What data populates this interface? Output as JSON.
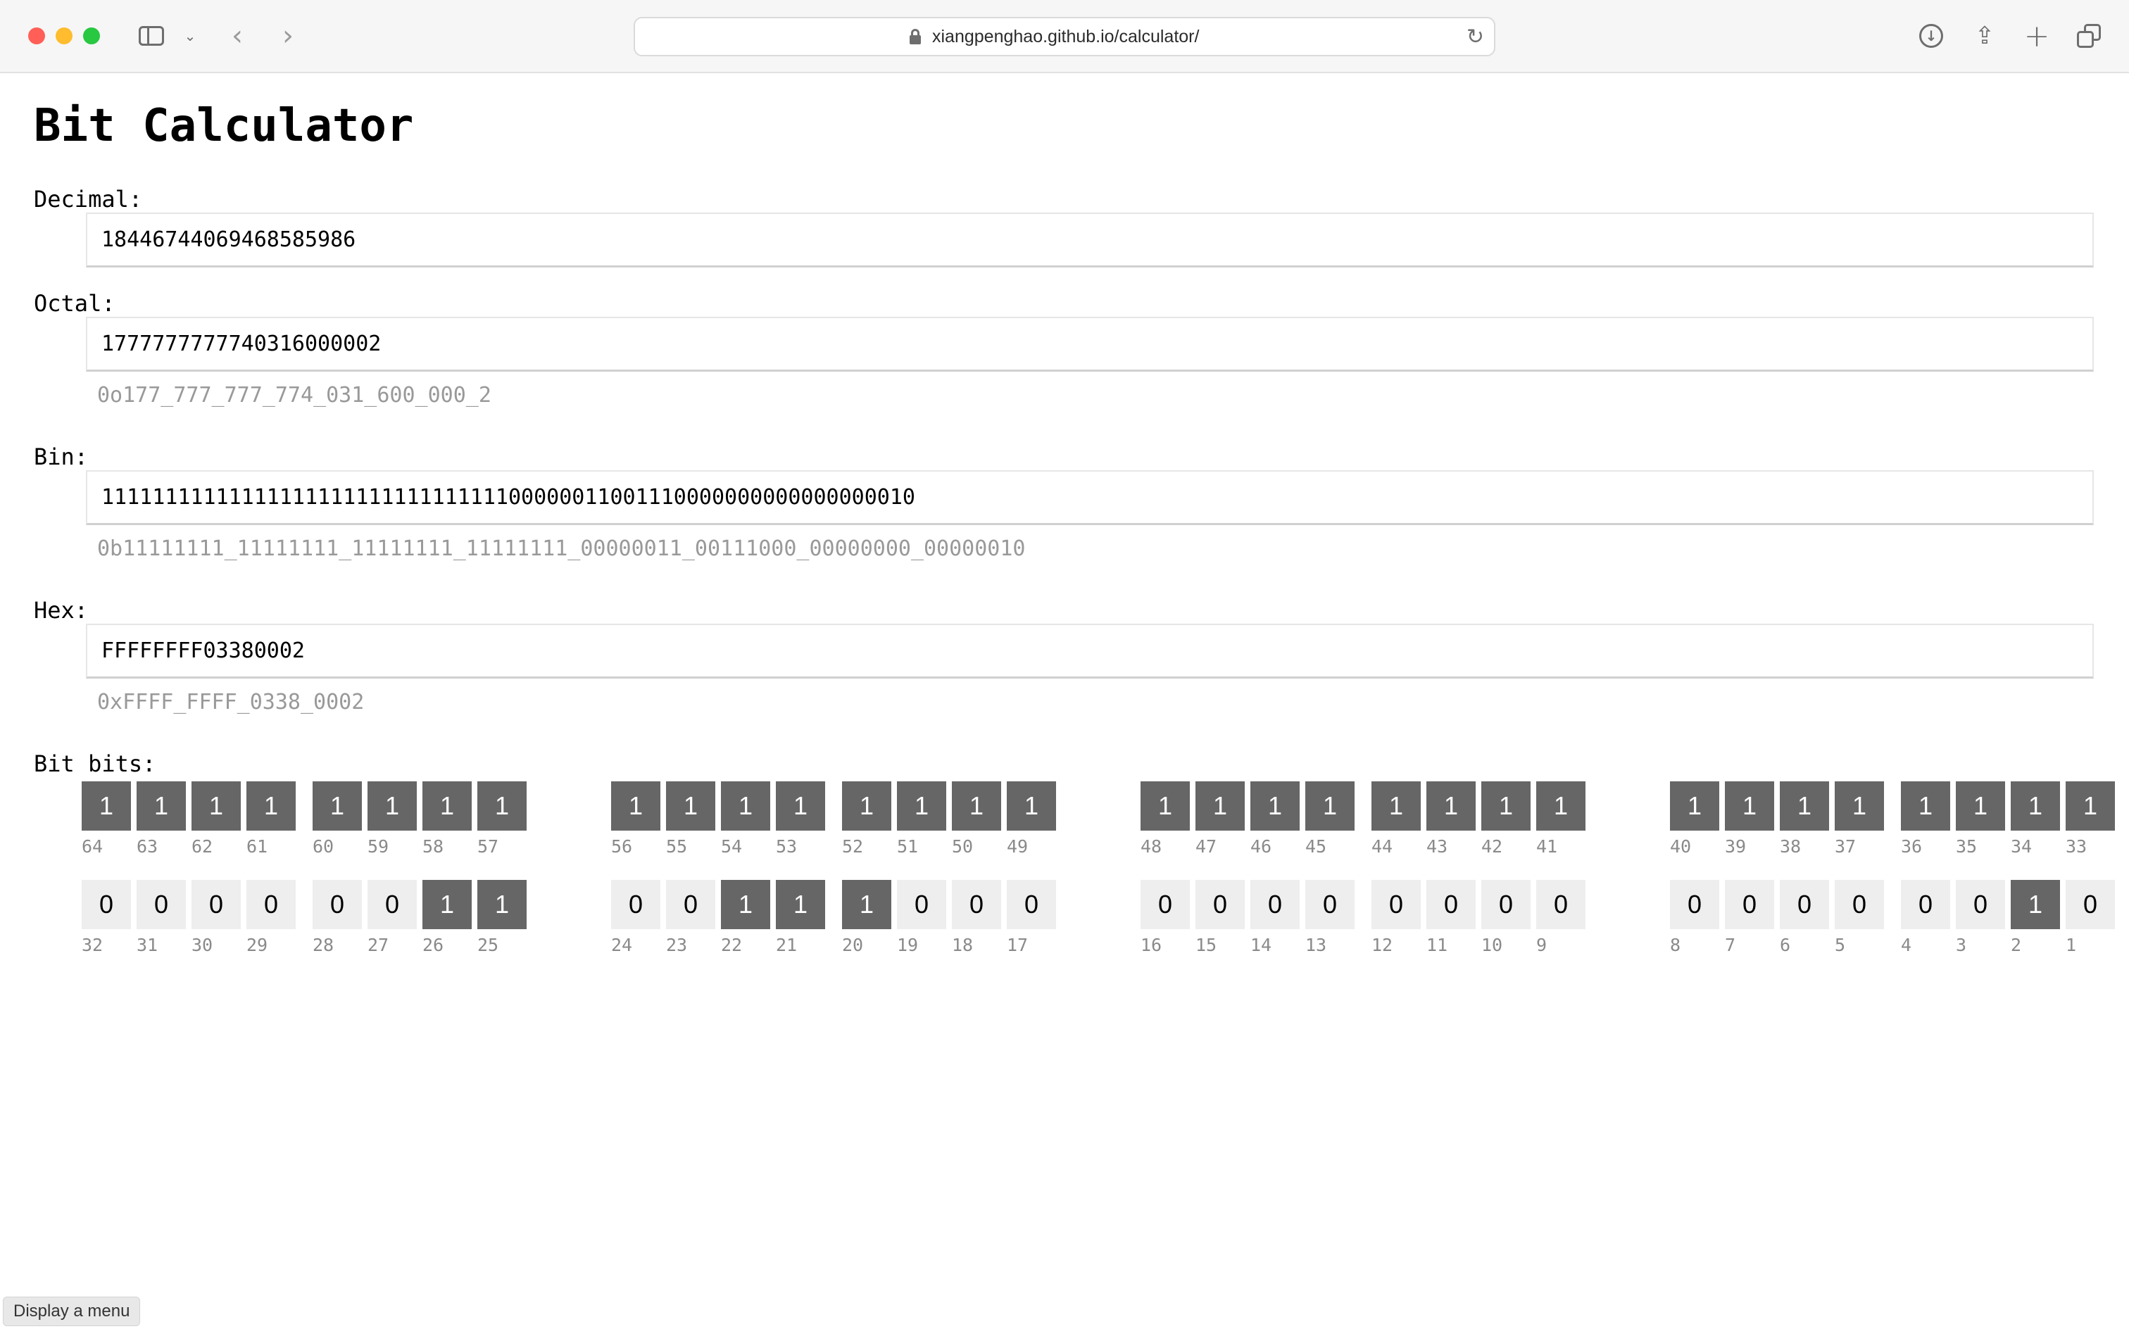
{
  "browser": {
    "url": "xiangpenghao.github.io/calculator/",
    "icons": [
      "close-button",
      "minimize-button",
      "maximize-button",
      "sidebar-icon",
      "chevron-down-icon",
      "back-icon",
      "forward-icon",
      "lock-icon",
      "reload-icon",
      "download-icon",
      "share-icon",
      "new-tab-icon",
      "tab-overview-icon"
    ]
  },
  "page": {
    "title": "Bit Calculator",
    "decimal": {
      "label": "Decimal:",
      "value": "18446744069468585986"
    },
    "octal": {
      "label": "Octal:",
      "value": "1777777777740316000002",
      "formatted": "0o177_777_777_774_031_600_000_2"
    },
    "bin": {
      "label": "Bin:",
      "value": "1111111111111111111111111111111100000011001110000000000000000010",
      "formatted": "0b11111111_11111111_11111111_11111111_00000011_00111000_00000000_00000010"
    },
    "hex": {
      "label": "Hex:",
      "value": "FFFFFFFF03380002",
      "formatted": "0xFFFF_FFFF_0338_0002"
    },
    "bits_label": "Bit bits:",
    "bit_rows": [
      {
        "bits": [
          "1",
          "1",
          "1",
          "1",
          "1",
          "1",
          "1",
          "1",
          "1",
          "1",
          "1",
          "1",
          "1",
          "1",
          "1",
          "1",
          "1",
          "1",
          "1",
          "1",
          "1",
          "1",
          "1",
          "1",
          "1",
          "1",
          "1",
          "1",
          "1",
          "1",
          "1",
          "1"
        ],
        "numbers": [
          "64",
          "63",
          "62",
          "61",
          "60",
          "59",
          "58",
          "57",
          "56",
          "55",
          "54",
          "53",
          "52",
          "51",
          "50",
          "49",
          "48",
          "47",
          "46",
          "45",
          "44",
          "43",
          "42",
          "41",
          "40",
          "39",
          "38",
          "37",
          "36",
          "35",
          "34",
          "33"
        ]
      },
      {
        "bits": [
          "0",
          "0",
          "0",
          "0",
          "0",
          "0",
          "1",
          "1",
          "0",
          "0",
          "1",
          "1",
          "1",
          "0",
          "0",
          "0",
          "0",
          "0",
          "0",
          "0",
          "0",
          "0",
          "0",
          "0",
          "0",
          "0",
          "0",
          "0",
          "0",
          "0",
          "1",
          "0"
        ],
        "numbers": [
          "32",
          "31",
          "30",
          "29",
          "28",
          "27",
          "26",
          "25",
          "24",
          "23",
          "22",
          "21",
          "20",
          "19",
          "18",
          "17",
          "16",
          "15",
          "14",
          "13",
          "12",
          "11",
          "10",
          "9",
          "8",
          "7",
          "6",
          "5",
          "4",
          "3",
          "2",
          "1"
        ]
      }
    ]
  },
  "status_bar": {
    "text": "Display a menu"
  },
  "colors": {
    "bit_on": "#666666",
    "bit_off": "#eeeeee",
    "hint": "#999999"
  }
}
